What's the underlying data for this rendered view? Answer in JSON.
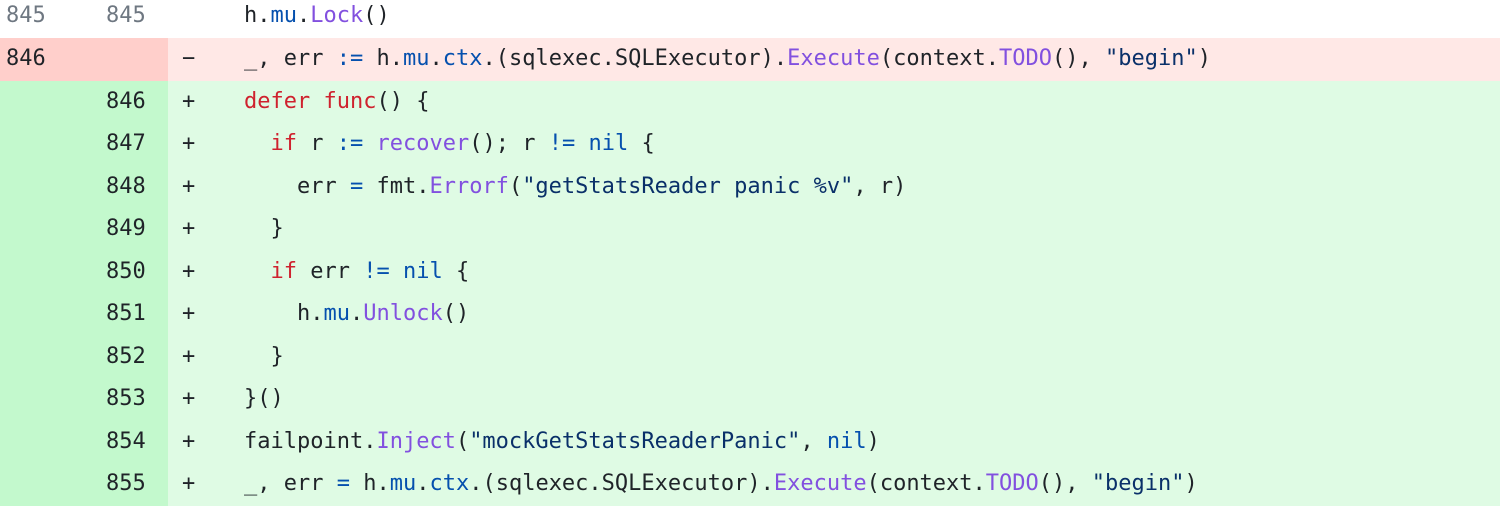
{
  "colors": {
    "keyword": "#cf222e",
    "identifier": "#0550ae",
    "function": "#8250df",
    "string": "#0a3069",
    "del_gutter": "#ffcfcb",
    "del_line": "#ffe8e6",
    "add_gutter": "#c3f9cd",
    "add_line": "#dffbe4"
  },
  "lines": [
    {
      "type": "ctx",
      "old": "845",
      "new": "845",
      "marker": "",
      "tokens": [
        [
          "h.",
          ""
        ],
        [
          "mu",
          "bl"
        ],
        [
          ".",
          ""
        ],
        [
          "Lock",
          "fn"
        ],
        [
          "()",
          ""
        ]
      ]
    },
    {
      "type": "del",
      "old": "846",
      "new": "",
      "marker": "−",
      "tokens": [
        [
          "_, err ",
          ""
        ],
        [
          ":=",
          "bl"
        ],
        [
          " h.",
          ""
        ],
        [
          "mu",
          "bl"
        ],
        [
          ".",
          ""
        ],
        [
          "ctx",
          "bl"
        ],
        [
          ".(sqlexec.SQLExecutor).",
          ""
        ],
        [
          "Execute",
          "fn"
        ],
        [
          "(context.",
          ""
        ],
        [
          "TODO",
          "fn"
        ],
        [
          "(), ",
          ""
        ],
        [
          "\"begin\"",
          "st"
        ],
        [
          ")",
          ""
        ]
      ]
    },
    {
      "type": "add",
      "old": "",
      "new": "846",
      "marker": "+",
      "tokens": [
        [
          "defer",
          "kw"
        ],
        [
          " ",
          ""
        ],
        [
          "func",
          "kw"
        ],
        [
          "() {",
          ""
        ]
      ]
    },
    {
      "type": "add",
      "old": "",
      "new": "847",
      "marker": "+",
      "tokens": [
        [
          "  ",
          ""
        ],
        [
          "if",
          "kw"
        ],
        [
          " r ",
          ""
        ],
        [
          ":=",
          "bl"
        ],
        [
          " ",
          ""
        ],
        [
          "recover",
          "fn"
        ],
        [
          "(); r ",
          ""
        ],
        [
          "!=",
          "bl"
        ],
        [
          " ",
          ""
        ],
        [
          "nil",
          "bl"
        ],
        [
          " {",
          ""
        ]
      ]
    },
    {
      "type": "add",
      "old": "",
      "new": "848",
      "marker": "+",
      "tokens": [
        [
          "    err ",
          ""
        ],
        [
          "=",
          "bl"
        ],
        [
          " fmt.",
          ""
        ],
        [
          "Errorf",
          "fn"
        ],
        [
          "(",
          ""
        ],
        [
          "\"getStatsReader panic %v\"",
          "st"
        ],
        [
          ", r)",
          ""
        ]
      ]
    },
    {
      "type": "add",
      "old": "",
      "new": "849",
      "marker": "+",
      "tokens": [
        [
          "  }",
          ""
        ]
      ]
    },
    {
      "type": "add",
      "old": "",
      "new": "850",
      "marker": "+",
      "tokens": [
        [
          "  ",
          ""
        ],
        [
          "if",
          "kw"
        ],
        [
          " err ",
          ""
        ],
        [
          "!=",
          "bl"
        ],
        [
          " ",
          ""
        ],
        [
          "nil",
          "bl"
        ],
        [
          " {",
          ""
        ]
      ]
    },
    {
      "type": "add",
      "old": "",
      "new": "851",
      "marker": "+",
      "tokens": [
        [
          "    h.",
          ""
        ],
        [
          "mu",
          "bl"
        ],
        [
          ".",
          ""
        ],
        [
          "Unlock",
          "fn"
        ],
        [
          "()",
          ""
        ]
      ]
    },
    {
      "type": "add",
      "old": "",
      "new": "852",
      "marker": "+",
      "tokens": [
        [
          "  }",
          ""
        ]
      ]
    },
    {
      "type": "add",
      "old": "",
      "new": "853",
      "marker": "+",
      "tokens": [
        [
          "}()",
          ""
        ]
      ]
    },
    {
      "type": "add",
      "old": "",
      "new": "854",
      "marker": "+",
      "tokens": [
        [
          "failpoint.",
          ""
        ],
        [
          "Inject",
          "fn"
        ],
        [
          "(",
          ""
        ],
        [
          "\"mockGetStatsReaderPanic\"",
          "st"
        ],
        [
          ", ",
          ""
        ],
        [
          "nil",
          "bl"
        ],
        [
          ")",
          ""
        ]
      ]
    },
    {
      "type": "add",
      "old": "",
      "new": "855",
      "marker": "+",
      "tokens": [
        [
          "_, err ",
          ""
        ],
        [
          "=",
          "bl"
        ],
        [
          " h.",
          ""
        ],
        [
          "mu",
          "bl"
        ],
        [
          ".",
          ""
        ],
        [
          "ctx",
          "bl"
        ],
        [
          ".(sqlexec.SQLExecutor).",
          ""
        ],
        [
          "Execute",
          "fn"
        ],
        [
          "(context.",
          ""
        ],
        [
          "TODO",
          "fn"
        ],
        [
          "(), ",
          ""
        ],
        [
          "\"begin\"",
          "st"
        ],
        [
          ")",
          ""
        ]
      ]
    }
  ]
}
